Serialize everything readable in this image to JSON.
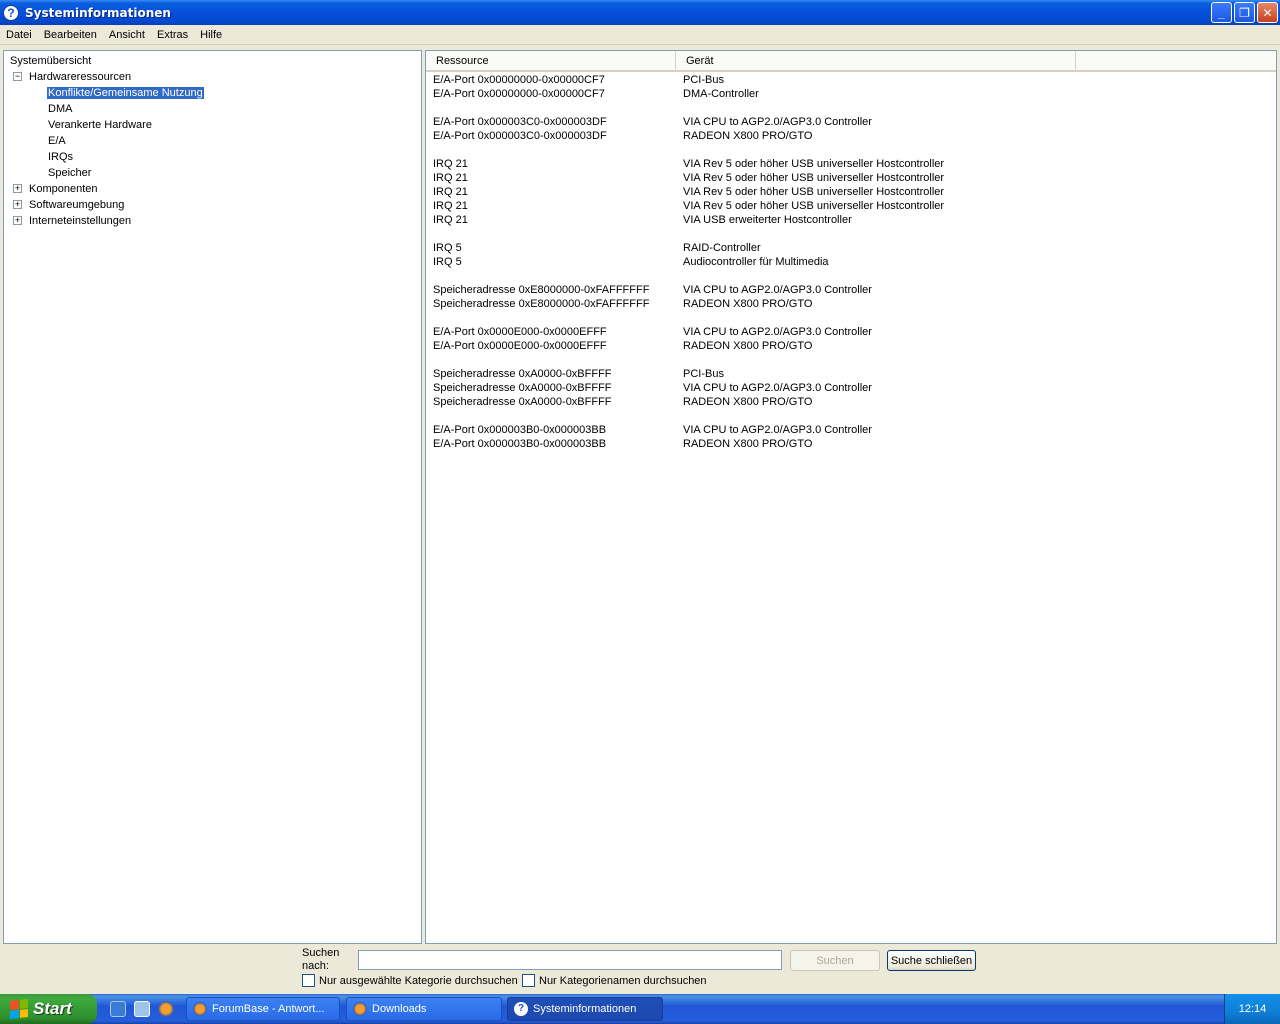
{
  "window": {
    "title": "Systeminformationen",
    "buttons": {
      "minimize": "_",
      "maximize": "❐",
      "close": "✕"
    }
  },
  "menu": [
    "Datei",
    "Bearbeiten",
    "Ansicht",
    "Extras",
    "Hilfe"
  ],
  "tree": {
    "root": "Systemübersicht",
    "hardware": "Hardwareressourcen",
    "hardware_children": [
      "Konflikte/Gemeinsame Nutzung",
      "DMA",
      "Verankerte Hardware",
      "E/A",
      "IRQs",
      "Speicher"
    ],
    "selected": "Konflikte/Gemeinsame Nutzung",
    "collapsed": [
      "Komponenten",
      "Softwareumgebung",
      "Interneteinstellungen"
    ]
  },
  "list": {
    "columns": [
      "Ressource",
      "Gerät"
    ],
    "groups": [
      [
        [
          "E/A-Port 0x00000000-0x00000CF7",
          "PCI-Bus"
        ],
        [
          "E/A-Port 0x00000000-0x00000CF7",
          "DMA-Controller"
        ]
      ],
      [
        [
          "E/A-Port 0x000003C0-0x000003DF",
          "VIA CPU to AGP2.0/AGP3.0 Controller"
        ],
        [
          "E/A-Port 0x000003C0-0x000003DF",
          "RADEON X800 PRO/GTO"
        ]
      ],
      [
        [
          "IRQ 21",
          "VIA Rev 5 oder höher USB universeller Hostcontroller"
        ],
        [
          "IRQ 21",
          "VIA Rev 5 oder höher USB universeller Hostcontroller"
        ],
        [
          "IRQ 21",
          "VIA Rev 5 oder höher USB universeller Hostcontroller"
        ],
        [
          "IRQ 21",
          "VIA Rev 5 oder höher USB universeller Hostcontroller"
        ],
        [
          "IRQ 21",
          "VIA USB erweiterter Hostcontroller"
        ]
      ],
      [
        [
          "IRQ 5",
          "RAID-Controller"
        ],
        [
          "IRQ 5",
          "Audiocontroller für Multimedia"
        ]
      ],
      [
        [
          "Speicheradresse 0xE8000000-0xFAFFFFFF",
          "VIA CPU to AGP2.0/AGP3.0 Controller"
        ],
        [
          "Speicheradresse 0xE8000000-0xFAFFFFFF",
          "RADEON X800 PRO/GTO"
        ]
      ],
      [
        [
          "E/A-Port 0x0000E000-0x0000EFFF",
          "VIA CPU to AGP2.0/AGP3.0 Controller"
        ],
        [
          "E/A-Port 0x0000E000-0x0000EFFF",
          "RADEON X800 PRO/GTO"
        ]
      ],
      [
        [
          "Speicheradresse 0xA0000-0xBFFFF",
          "PCI-Bus"
        ],
        [
          "Speicheradresse 0xA0000-0xBFFFF",
          "VIA CPU to AGP2.0/AGP3.0 Controller"
        ],
        [
          "Speicheradresse 0xA0000-0xBFFFF",
          "RADEON X800 PRO/GTO"
        ]
      ],
      [
        [
          "E/A-Port 0x000003B0-0x000003BB",
          "VIA CPU to AGP2.0/AGP3.0 Controller"
        ],
        [
          "E/A-Port 0x000003B0-0x000003BB",
          "RADEON X800 PRO/GTO"
        ]
      ]
    ]
  },
  "search": {
    "label_line1": "Suchen",
    "label_line2": "nach:",
    "value": "",
    "search_button": "Suchen",
    "close_button": "Suche schließen",
    "option1": "Nur ausgewählte Kategorie durchsuchen",
    "option2": "Nur Kategorienamen durchsuchen"
  },
  "taskbar": {
    "start": "Start",
    "tasks": [
      "ForumBase - Antwort...",
      "Downloads",
      "Systeminformationen"
    ],
    "active_task": "Systeminformationen",
    "clock": "12:14"
  }
}
